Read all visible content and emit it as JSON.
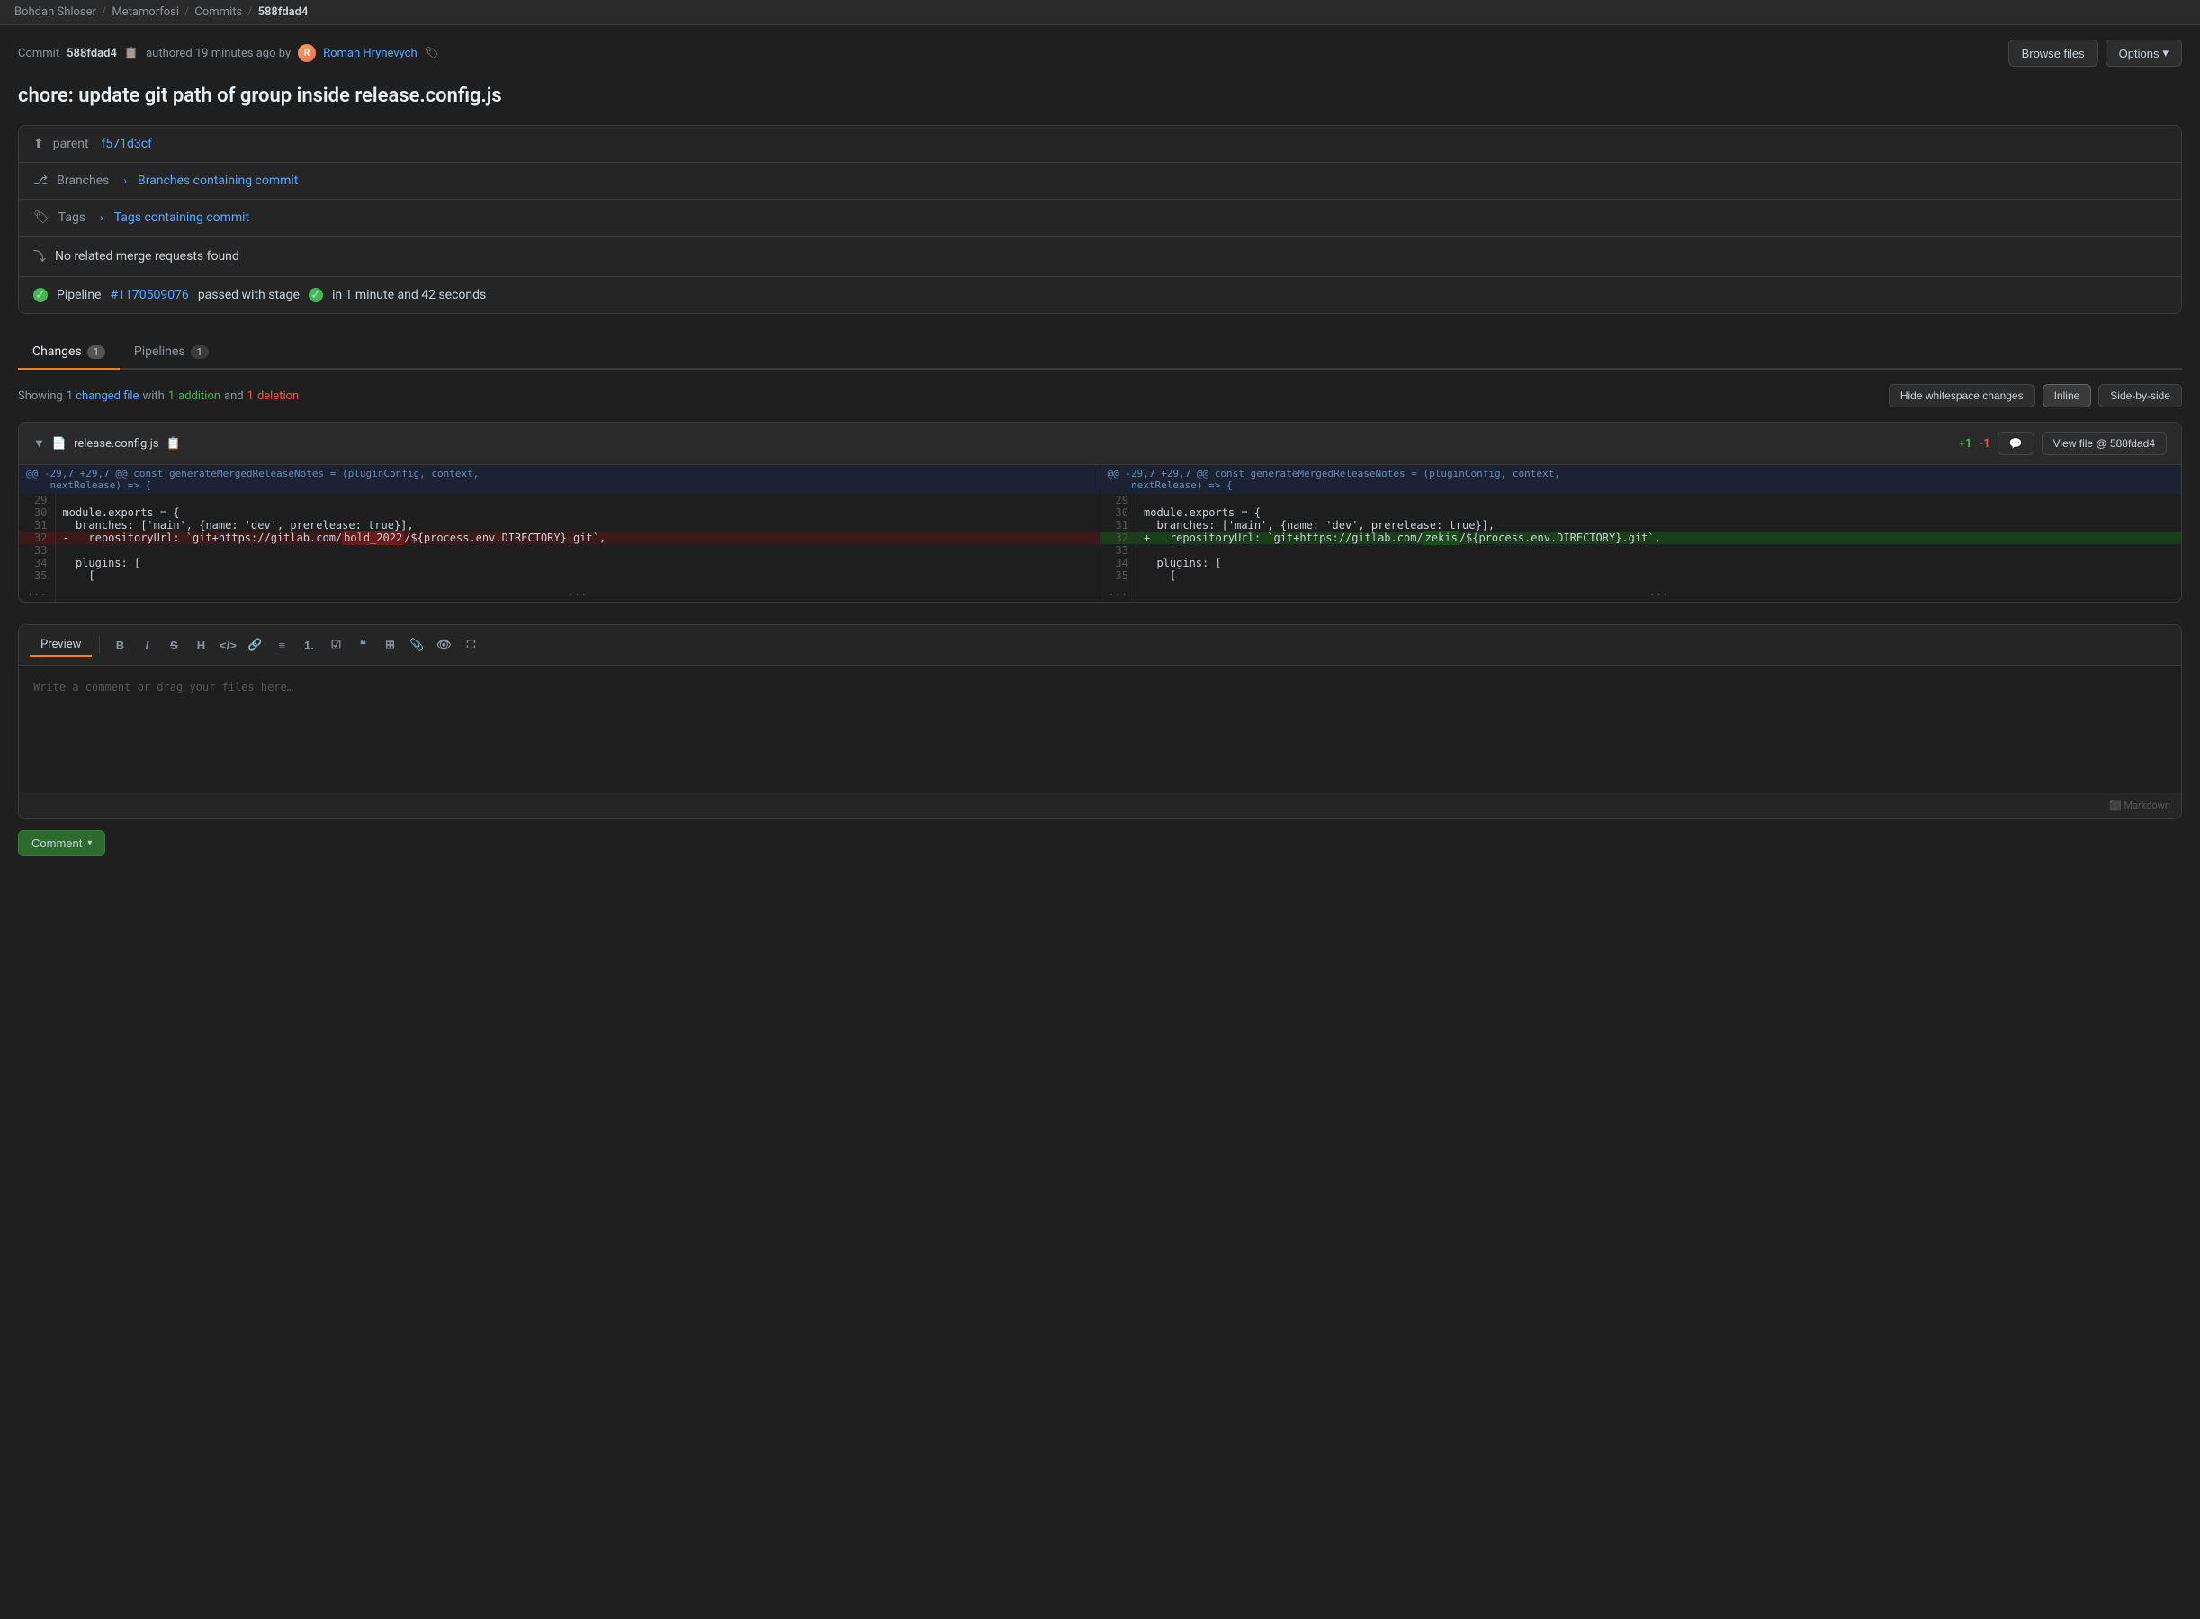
{
  "topbar": {
    "user": "Bohdan Shloser",
    "sep1": "/",
    "project": "Metamorfosi",
    "sep2": "/",
    "link3": "Commits",
    "sep3": "/",
    "current": "588fdad4"
  },
  "commit_header": {
    "label": "Commit",
    "hash": "588fdad4",
    "authored": "authored 19 minutes ago by",
    "author": "Roman Hrynevych",
    "browse_files": "Browse files",
    "options": "Options"
  },
  "commit_title": "chore: update git path of group inside release.config.js",
  "info": {
    "parent_label": "parent",
    "parent_hash": "f571d3cf",
    "branches_label": "Branches",
    "branches_link": "Branches containing commit",
    "tags_label": "Tags",
    "tags_link": "Tags containing commit",
    "no_mr": "No related merge requests found",
    "pipeline_label": "Pipeline",
    "pipeline_link": "#1170509076",
    "pipeline_status": "passed with stage",
    "pipeline_time": "in 1 minute and 42 seconds"
  },
  "tabs": {
    "changes_label": "Changes",
    "changes_count": "1",
    "pipelines_label": "Pipelines",
    "pipelines_count": "1"
  },
  "changes_summary": {
    "showing": "Showing",
    "changed_count": "1",
    "changed_file": "changed file",
    "with": "with",
    "additions": "1",
    "additions_label": "addition",
    "and": "and",
    "deletions": "1",
    "deletions_label": "deletion",
    "hide_whitespace": "Hide whitespace changes",
    "inline": "Inline",
    "side_by_side": "Side-by-side"
  },
  "diff": {
    "filename": "release.config.js",
    "stat_add": "+1",
    "stat_del": "-1",
    "view_file": "View file @ 588fdad4",
    "hunk": "@@ -29,7 +29,7 @@ const generateMergedReleaseNotes = (pluginConfig, context, nextRelease) => {",
    "left": {
      "lines": [
        {
          "num": "29",
          "type": "context",
          "content": ""
        },
        {
          "num": "30",
          "type": "context",
          "content": "module.exports = {"
        },
        {
          "num": "31",
          "type": "context",
          "content": "  branches: ['main', {name: 'dev', prerelease: true}],"
        },
        {
          "num": "32",
          "type": "removed",
          "content": "-   repositoryUrl: `git+https://gitlab.com/bold_2022/${process.env.DIRECTORY}.git`,"
        },
        {
          "num": "33",
          "type": "context",
          "content": ""
        },
        {
          "num": "34",
          "type": "context",
          "content": "  plugins: ["
        },
        {
          "num": "35",
          "type": "context",
          "content": "    ["
        }
      ]
    },
    "right": {
      "lines": [
        {
          "num": "29",
          "type": "context",
          "content": ""
        },
        {
          "num": "30",
          "type": "context",
          "content": "module.exports = {"
        },
        {
          "num": "31",
          "type": "context",
          "content": "  branches: ['main', {name: 'dev', prerelease: true}],"
        },
        {
          "num": "32",
          "type": "added",
          "content": "+   repositoryUrl: `git+https://gitlab.com/zekis/${process.env.DIRECTORY}.git`,"
        },
        {
          "num": "33",
          "type": "context",
          "content": ""
        },
        {
          "num": "34",
          "type": "context",
          "content": "  plugins: ["
        },
        {
          "num": "35",
          "type": "context",
          "content": "    ["
        }
      ]
    }
  },
  "comment_box": {
    "preview_tab": "Preview",
    "bold": "B",
    "italic": "I",
    "strikethrough": "S",
    "heading": "H",
    "code_inline": "</>",
    "link": "🔗",
    "bullet_list": "≡",
    "numbered_list": "1.",
    "task_list": "☑",
    "block_quote": "❝",
    "table": "⊞",
    "attach": "📎",
    "preview_icon": "👁",
    "fullscreen": "⛶",
    "placeholder": "Write a comment or drag your files here…",
    "comment_button": "Comment",
    "comment_chevron": "▾"
  }
}
